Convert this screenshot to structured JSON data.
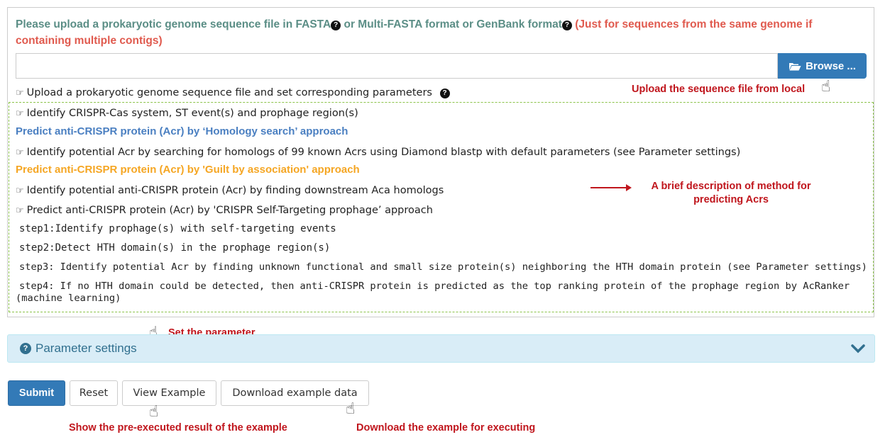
{
  "upload": {
    "title_part1": "Please upload a prokaryotic genome sequence file in FASTA",
    "title_part2": " or Multi-FASTA format or GenBank format",
    "title_note": " (Just for sequences from the same genome if containing multiple contigs)",
    "file_value": "",
    "browse_label": "Browse ..."
  },
  "steps": {
    "upload_step": "Upload a prokaryotic genome sequence file and set corresponding parameters",
    "identify_crispr": "Identify CRISPR-Cas system, ST event(s) and prophage region(s)",
    "homology_heading": "Predict anti-CRISPR protein (Acr) by ‘Homology search’ approach",
    "homology_desc": "Identify potential Acr by searching for homologs of 99 known Acrs using Diamond blastp with default parameters (see Parameter settings)",
    "guilt_heading": "Predict anti-CRISPR protein (Acr) by 'Guilt by association' approach",
    "guilt_desc": "Identify potential anti-CRISPR protein (Acr) by finding downstream Aca homologs",
    "selftarget_desc": "Predict anti-CRISPR protein (Acr) by 'CRISPR Self-Targeting prophage’ approach",
    "step1": "step1:Identify prophage(s) with self-targeting events",
    "step2": "step2:Detect HTH domain(s) in the prophage region(s)",
    "step3": "step3: Identify potential Acr by finding unknown functional and small size protein(s) neighboring the HTH domain protein (see Parameter settings)",
    "step4": "step4: If no HTH domain could be detected, then anti-CRISPR protein is predicted as the top ranking protein of the prophage region by AcRanker (machine learning)"
  },
  "annotations": {
    "upload_local": "Upload the sequence file from local",
    "brief_desc_line1": "A brief description of method for",
    "brief_desc_line2": "predicting Acrs",
    "set_parameter": "Set the parameter",
    "show_result": "Show the pre-executed result of the example",
    "download_example": "Download the example for executing"
  },
  "parameter_settings": {
    "label": "Parameter settings"
  },
  "buttons": {
    "submit": "Submit",
    "reset": "Reset",
    "view_example": "View Example",
    "download_data": "Download example data"
  },
  "icons": {
    "question": "question-circle-icon",
    "hand": "hand-pointer-icon",
    "folder": "folder-open-icon",
    "chevron": "chevron-down-icon"
  },
  "colors": {
    "title_green": "#5b8e86",
    "note_red": "#e05a4e",
    "primary_blue": "#337ab7",
    "heading_blue": "#4a7fc1",
    "heading_orange": "#f5a623",
    "annotation_red": "#c0161d",
    "panel_info": "#d9edf7"
  }
}
